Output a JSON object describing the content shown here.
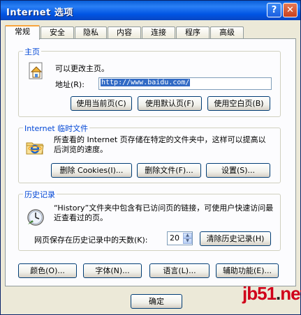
{
  "window": {
    "title": "Internet 选项",
    "help_label": "?",
    "close_label": "✕"
  },
  "tabs": [
    {
      "label": "常规",
      "active": true
    },
    {
      "label": "安全"
    },
    {
      "label": "隐私"
    },
    {
      "label": "内容"
    },
    {
      "label": "连接"
    },
    {
      "label": "程序"
    },
    {
      "label": "高级"
    }
  ],
  "home": {
    "legend": "主页",
    "description": "可以更改主页。",
    "address_label": "地址(R):",
    "address_value": "http://www.baidu.com/",
    "buttons": {
      "use_current": "使用当前页(C)",
      "use_default": "使用默认页(F)",
      "use_blank": "使用空白页(B)"
    },
    "icon": "home-page-icon"
  },
  "temp_files": {
    "legend": "Internet 临时文件",
    "description": "所查看的 Internet 页存储在特定的文件夹中，这样可以提高以后浏览的速度。",
    "buttons": {
      "delete_cookies": "删除 Cookies(I)...",
      "delete_files": "删除文件(F)...",
      "settings": "设置(S)..."
    },
    "icon": "ie-folder-icon"
  },
  "history": {
    "legend": "历史记录",
    "description": "“History”文件夹中包含有已访问页的链接，可使用户快速访问最近查看过的页。",
    "days_label": "网页保存在历史记录中的天数(K):",
    "days_value": "20",
    "clear_button": "清除历史记录(H)",
    "icon": "history-clock-icon"
  },
  "bottom_buttons": {
    "colors": "颜色(O)...",
    "fonts": "字体(N)...",
    "languages": "语言(L)...",
    "accessibility": "辅助功能(E)..."
  },
  "footer": {
    "ok": "确定"
  },
  "watermark": {
    "text_main": "jb51",
    "text_dot": ".",
    "text_tld": "net"
  },
  "colors": {
    "title_bar": "#0054e3",
    "legend": "#0046d5",
    "dialog_bg": "#ece9d8",
    "selection": "#316ac5",
    "watermark": "#d0001a"
  }
}
